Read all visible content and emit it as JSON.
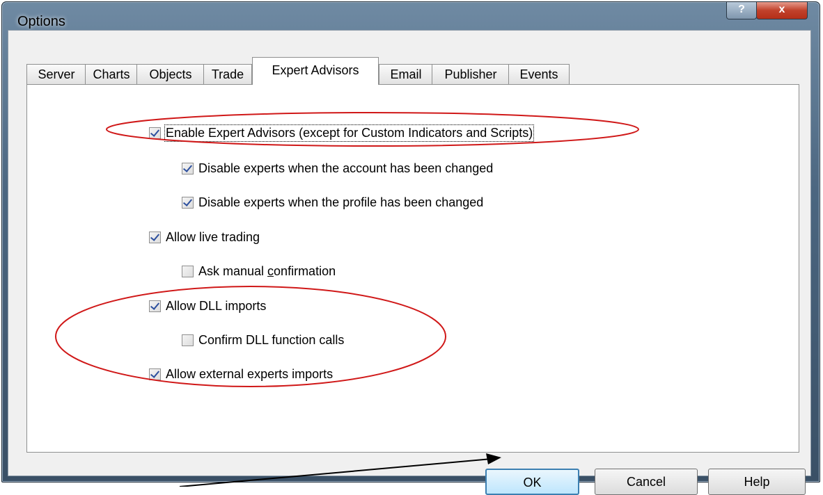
{
  "window": {
    "title": "Options",
    "help_symbol": "?",
    "close_symbol": "x"
  },
  "tabs": [
    {
      "label": "Server"
    },
    {
      "label": "Charts"
    },
    {
      "label": "Objects"
    },
    {
      "label": "Trade"
    },
    {
      "label": "Expert Advisors",
      "active": true
    },
    {
      "label": "Email"
    },
    {
      "label": "Publisher"
    },
    {
      "label": "Events"
    }
  ],
  "options": {
    "enable_experts": {
      "label": "Enable Expert Advisors (except for Custom Indicators and Scripts)",
      "checked": true
    },
    "disable_account": {
      "label": "Disable experts when the account has been changed",
      "checked": true
    },
    "disable_profile": {
      "label": "Disable experts when the profile has been changed",
      "checked": true
    },
    "allow_live": {
      "label": "Allow live trading",
      "checked": true
    },
    "ask_manual": {
      "label_pre": "Ask manual ",
      "label_u": "c",
      "label_post": "onfirmation",
      "checked": false
    },
    "allow_dll": {
      "label": "Allow DLL imports",
      "checked": true
    },
    "confirm_dll": {
      "label": "Confirm DLL function calls",
      "checked": false
    },
    "allow_external": {
      "label": "Allow external experts imports",
      "checked": true
    }
  },
  "buttons": {
    "ok": "OK",
    "cancel": "Cancel",
    "help": "Help"
  },
  "annotation_color": "#d01818"
}
